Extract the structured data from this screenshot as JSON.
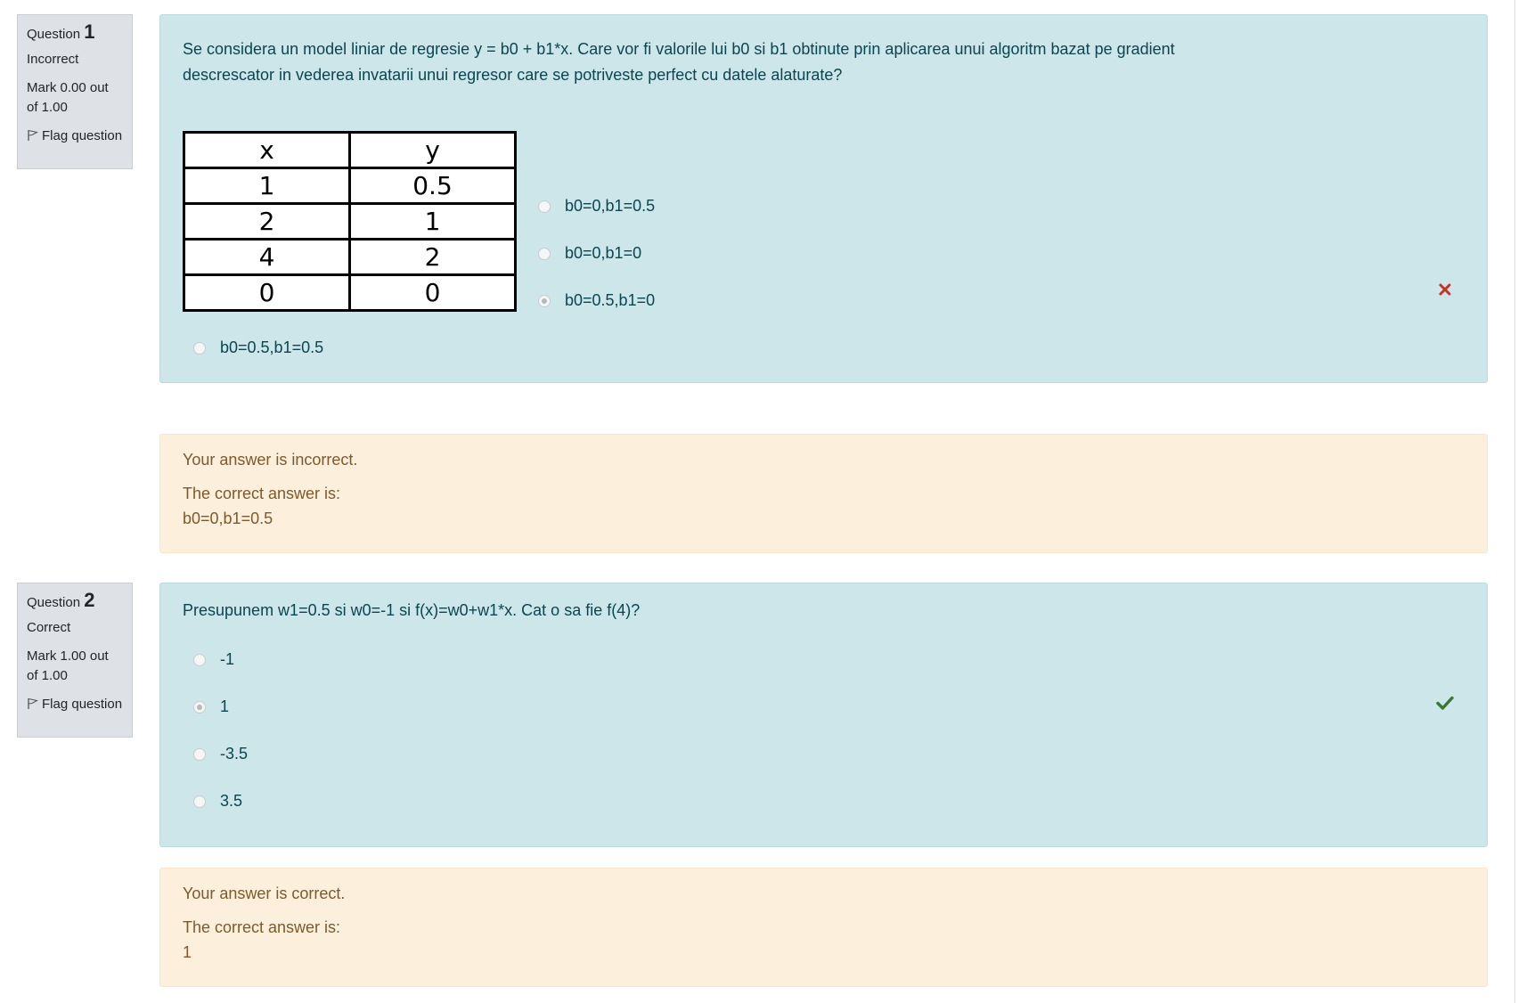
{
  "questions": [
    {
      "label": "Question",
      "number": "1",
      "state": "Incorrect",
      "grade": "Mark 0.00 out of 1.00",
      "flag_label": "Flag question",
      "text": "Se considera un model liniar de regresie y = b0 + b1*x. Care vor fi valorile lui b0 si b1 obtinute prin aplicarea unui algoritm bazat pe gradient descrescator in vederea invatarii unui regresor care se potriveste perfect cu datele alaturate?",
      "table": {
        "headers": [
          "x",
          "y"
        ],
        "rows": [
          [
            "1",
            "0.5"
          ],
          [
            "2",
            "1"
          ],
          [
            "4",
            "2"
          ],
          [
            "0",
            "0"
          ]
        ]
      },
      "options": [
        "b0=0,b1=0.5",
        "b0=0,b1=0",
        "b0=0.5,b1=0",
        "b0=0.5,b1=0.5"
      ],
      "selected_option": "b0=0.5,b1=0",
      "result_icon": "incorrect-cross-icon",
      "result_color": "#ca3120",
      "feedback": {
        "status": "Your answer is incorrect.",
        "correct_label": "The correct answer is:",
        "correct_value": "b0=0,b1=0.5"
      }
    },
    {
      "label": "Question",
      "number": "2",
      "state": "Correct",
      "grade": "Mark 1.00 out of 1.00",
      "flag_label": "Flag question",
      "text": "Presupunem w1=0.5 si w0=-1 si f(x)=w0+w1*x. Cat o sa fie f(4)?",
      "options": [
        "-1",
        "1",
        "-3.5",
        "3.5"
      ],
      "selected_option": "1",
      "result_icon": "correct-check-icon",
      "result_color": "#357a32",
      "feedback": {
        "status": "Your answer is correct.",
        "correct_label": "The correct answer is:",
        "correct_value": "1"
      }
    }
  ],
  "colors": {
    "formulation_bg": "#cde6ea",
    "feedback_bg": "#fcefdc",
    "info_bg": "#dee2e6",
    "text_primary": "#0a4650",
    "feedback_text": "#7d5a29"
  }
}
